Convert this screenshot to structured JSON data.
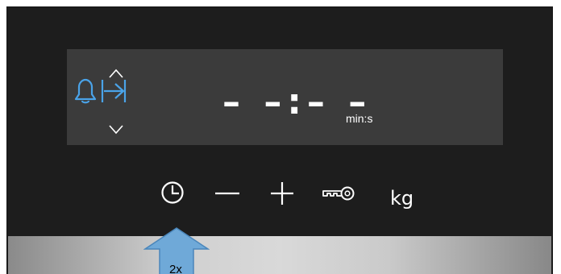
{
  "display": {
    "timer_value": "– –:– –",
    "unit": "min:s"
  },
  "icons": {
    "up": "chevron-up-icon",
    "down": "chevron-down-icon",
    "bell": "bell-icon",
    "timer": "timer-end-icon",
    "clock": "clock-icon",
    "minus": "minus-icon",
    "plus": "plus-icon",
    "key": "key-icon"
  },
  "buttons": {
    "weight_label": "kg"
  },
  "callout": {
    "label": "2x"
  },
  "colors": {
    "accent": "#4aa3e8",
    "arrow": "#6fa9d8"
  }
}
